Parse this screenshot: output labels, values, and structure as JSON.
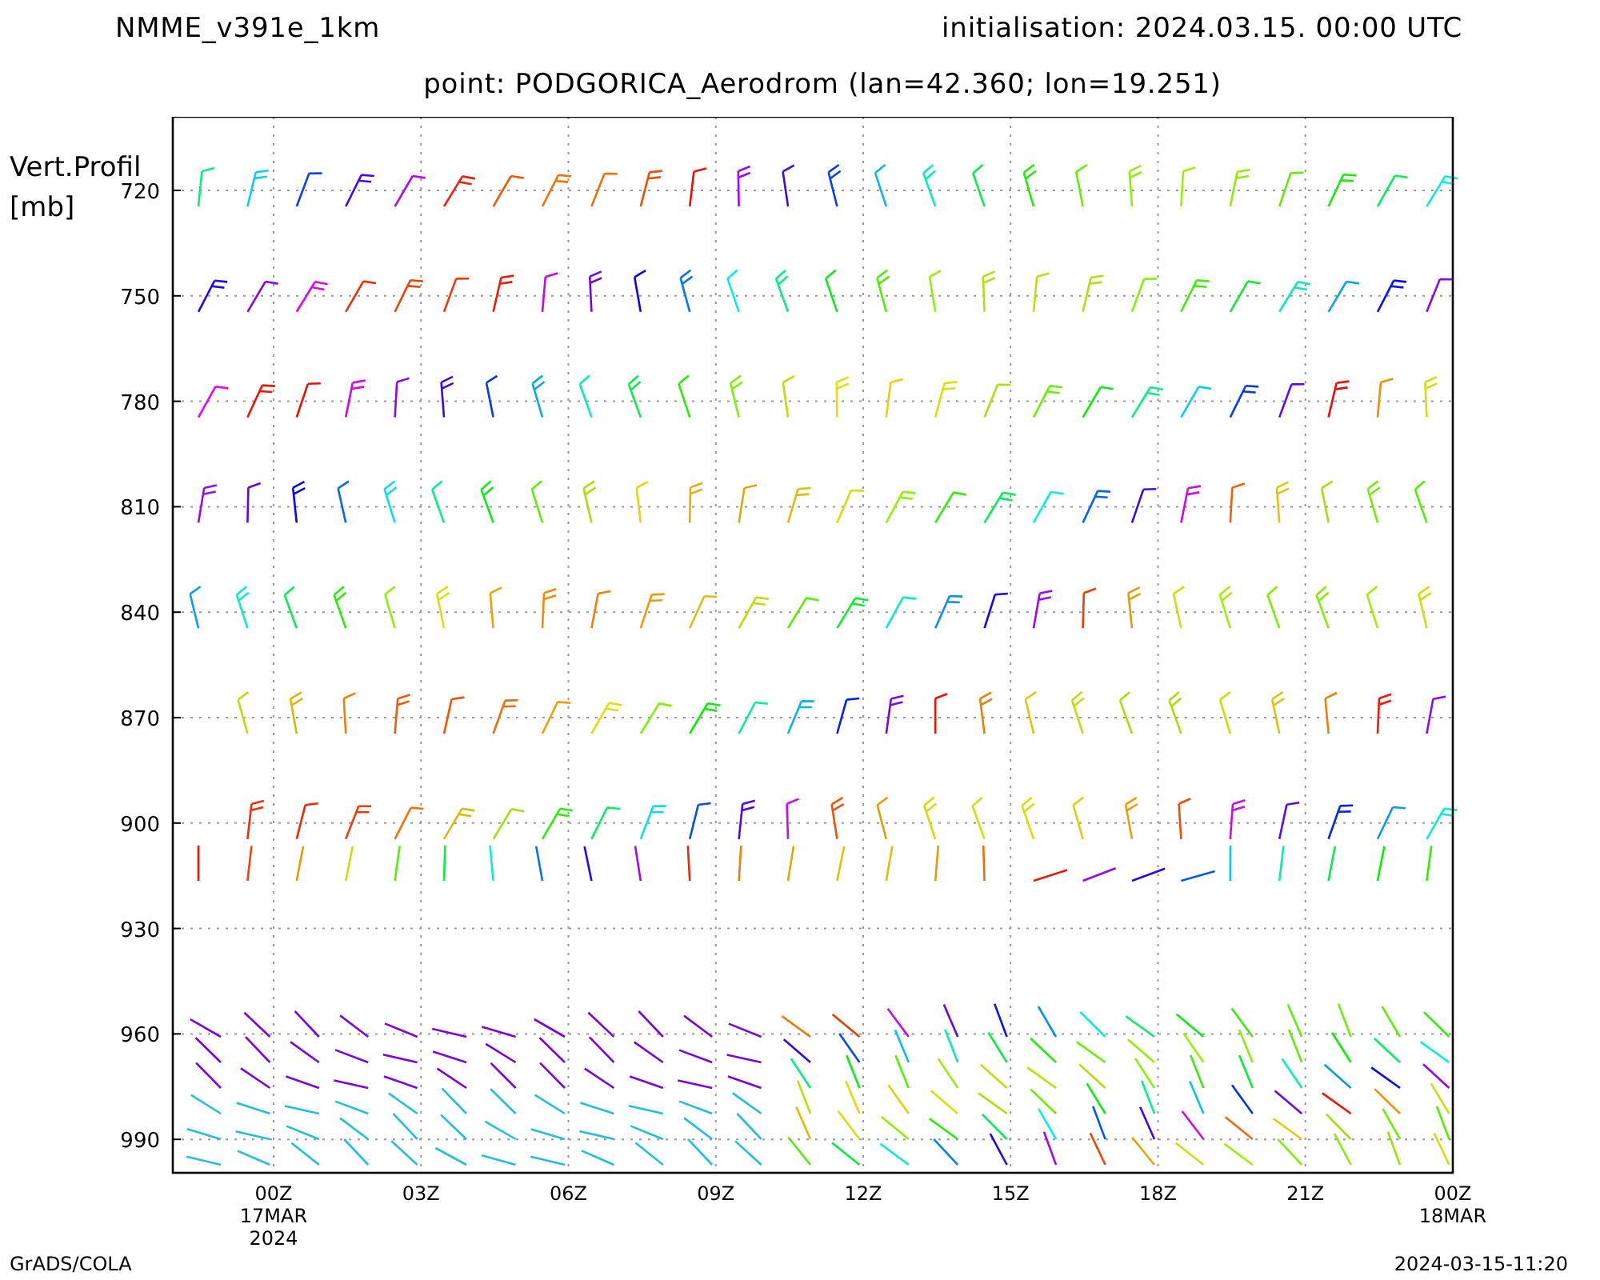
{
  "header": {
    "model": "NMME_v391e_1km",
    "initialisation": "initialisation: 2024.03.15. 00:00 UTC",
    "point": "point: PODGORICA_Aerodrom (lan=42.360; lon=19.251)"
  },
  "plot": {
    "y_label": [
      "Vert.Profil",
      "[mb]"
    ],
    "y_ticks": [
      "720",
      "750",
      "780",
      "810",
      "840",
      "870",
      "900",
      "930",
      "960",
      "990"
    ],
    "x_ticks": [
      {
        "lines": [
          "00Z",
          "17MAR",
          "2024"
        ]
      },
      {
        "lines": [
          "03Z"
        ]
      },
      {
        "lines": [
          "06Z"
        ]
      },
      {
        "lines": [
          "09Z"
        ]
      },
      {
        "lines": [
          "12Z"
        ]
      },
      {
        "lines": [
          "15Z"
        ]
      },
      {
        "lines": [
          "18Z"
        ]
      },
      {
        "lines": [
          "21Z"
        ]
      },
      {
        "lines": [
          "00Z",
          "18MAR"
        ]
      }
    ]
  },
  "footer": {
    "left": "GrADS/COLA",
    "right": "2024-03-15-11:20"
  }
}
